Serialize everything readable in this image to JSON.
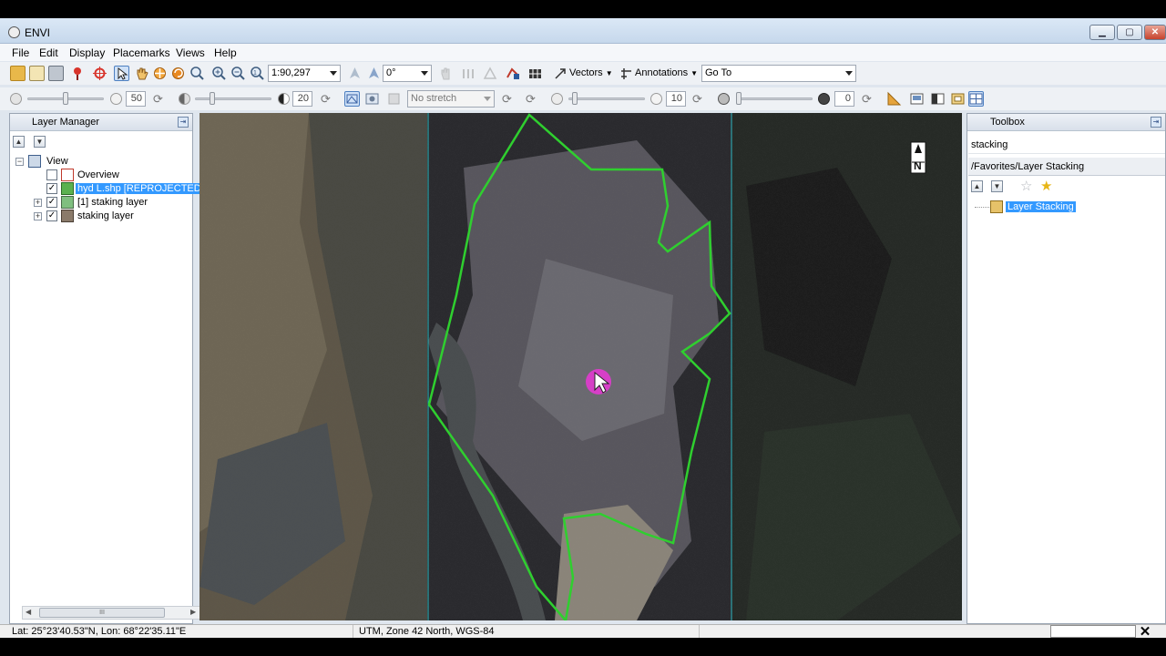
{
  "app": {
    "title": "ENVI"
  },
  "window_buttons": {
    "minimize": "▁",
    "maximize": "▢",
    "close": "✕"
  },
  "menu": [
    "File",
    "Edit",
    "Display",
    "Placemarks",
    "Views",
    "Help"
  ],
  "toolbar1": {
    "scale_value": "1:90,297",
    "rotation_value": "0°",
    "vectors_label": "Vectors",
    "annotations_label": "Annotations",
    "goto_value": "Go To"
  },
  "toolbar2": {
    "brightness_value": "50",
    "contrast_value": "20",
    "stretch_value": "No stretch",
    "sharpen_value": "10",
    "transparency_value": "0"
  },
  "layer_manager": {
    "title": "Layer Manager",
    "root_label": "View",
    "items": [
      {
        "label": "Overview",
        "checked": false,
        "selected": false,
        "expandable": false
      },
      {
        "label": "hyd L.shp [REPROJECTED]",
        "checked": true,
        "selected": true,
        "expandable": false
      },
      {
        "label": "[1] staking layer",
        "checked": true,
        "selected": false,
        "expandable": true
      },
      {
        "label": "staking layer",
        "checked": true,
        "selected": false,
        "expandable": true
      }
    ],
    "scroll_grip": "III"
  },
  "toolbox": {
    "title": "Toolbox",
    "search_value": "stacking",
    "path": "/Favorites/Layer Stacking",
    "tool_item": "Layer Stacking"
  },
  "map": {
    "north_label": "N",
    "outline_color": "#2fcf2f",
    "boundary_color": "#2fb8c2",
    "cursor_color": "#e23bd0"
  },
  "status": {
    "coords": "Lat: 25°23'40.53\"N, Lon: 68°22'35.11\"E",
    "projection": "UTM, Zone 42 North, WGS-84",
    "close_glyph": "✕"
  }
}
